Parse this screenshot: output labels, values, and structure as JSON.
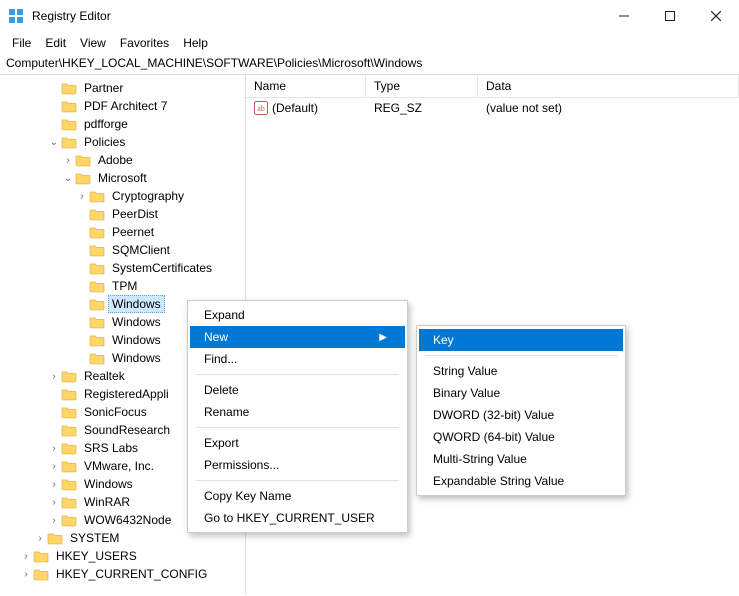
{
  "window": {
    "title": "Registry Editor"
  },
  "menu": [
    "File",
    "Edit",
    "View",
    "Favorites",
    "Help"
  ],
  "path": "Computer\\HKEY_LOCAL_MACHINE\\SOFTWARE\\Policies\\Microsoft\\Windows",
  "columns": {
    "name": "Name",
    "type": "Type",
    "data": "Data"
  },
  "values": [
    {
      "name": "(Default)",
      "type": "REG_SZ",
      "data": "(value not set)"
    }
  ],
  "tree": [
    {
      "d": 3,
      "t": "",
      "label": "Partner"
    },
    {
      "d": 3,
      "t": "",
      "label": "PDF Architect 7"
    },
    {
      "d": 3,
      "t": "",
      "label": "pdfforge"
    },
    {
      "d": 3,
      "t": "v",
      "label": "Policies"
    },
    {
      "d": 4,
      "t": ">",
      "label": "Adobe"
    },
    {
      "d": 4,
      "t": "v",
      "label": "Microsoft"
    },
    {
      "d": 5,
      "t": ">",
      "label": "Cryptography"
    },
    {
      "d": 5,
      "t": "",
      "label": "PeerDist"
    },
    {
      "d": 5,
      "t": "",
      "label": "Peernet"
    },
    {
      "d": 5,
      "t": "",
      "label": "SQMClient"
    },
    {
      "d": 5,
      "t": "",
      "label": "SystemCertificates"
    },
    {
      "d": 5,
      "t": "",
      "label": "TPM"
    },
    {
      "d": 5,
      "t": "",
      "label": "Windows",
      "sel": true
    },
    {
      "d": 5,
      "t": "",
      "label": "Windows"
    },
    {
      "d": 5,
      "t": "",
      "label": "Windows"
    },
    {
      "d": 5,
      "t": "",
      "label": "Windows"
    },
    {
      "d": 3,
      "t": ">",
      "label": "Realtek"
    },
    {
      "d": 3,
      "t": "",
      "label": "RegisteredAppli"
    },
    {
      "d": 3,
      "t": "",
      "label": "SonicFocus"
    },
    {
      "d": 3,
      "t": "",
      "label": "SoundResearch"
    },
    {
      "d": 3,
      "t": ">",
      "label": "SRS Labs"
    },
    {
      "d": 3,
      "t": ">",
      "label": "VMware, Inc."
    },
    {
      "d": 3,
      "t": ">",
      "label": "Windows"
    },
    {
      "d": 3,
      "t": ">",
      "label": "WinRAR"
    },
    {
      "d": 3,
      "t": ">",
      "label": "WOW6432Node"
    },
    {
      "d": 2,
      "t": ">",
      "label": "SYSTEM"
    },
    {
      "d": 1,
      "t": ">",
      "label": "HKEY_USERS"
    },
    {
      "d": 1,
      "t": ">",
      "label": "HKEY_CURRENT_CONFIG"
    }
  ],
  "context_main": {
    "expand": "Expand",
    "new": "New",
    "find": "Find...",
    "delete": "Delete",
    "rename": "Rename",
    "export": "Export",
    "permissions": "Permissions...",
    "copy_key": "Copy Key Name",
    "goto_hkcu": "Go to HKEY_CURRENT_USER"
  },
  "context_sub": {
    "key": "Key",
    "string": "String Value",
    "binary": "Binary Value",
    "dword": "DWORD (32-bit) Value",
    "qword": "QWORD (64-bit) Value",
    "multisz": "Multi-String Value",
    "expandsz": "Expandable String Value"
  }
}
